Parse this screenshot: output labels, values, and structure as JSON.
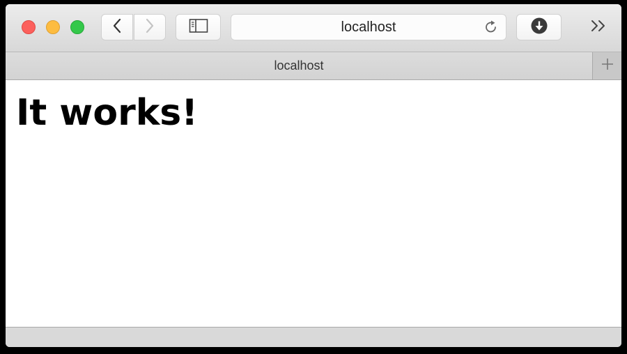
{
  "toolbar": {
    "address": "localhost",
    "buttons": {
      "back_icon": "chevron-left-icon",
      "forward_icon": "chevron-right-icon",
      "sidebar_icon": "sidebar-icon",
      "reload_icon": "reload-icon",
      "download_icon": "download-icon",
      "overflow_icon": "double-chevron-right-icon"
    }
  },
  "tabbar": {
    "active_tab_title": "localhost",
    "new_tab_icon": "plus-icon"
  },
  "page": {
    "heading": "It works!"
  },
  "colors": {
    "close": "#fc605c",
    "minimize": "#fdbc40",
    "maximize": "#34c84a"
  }
}
